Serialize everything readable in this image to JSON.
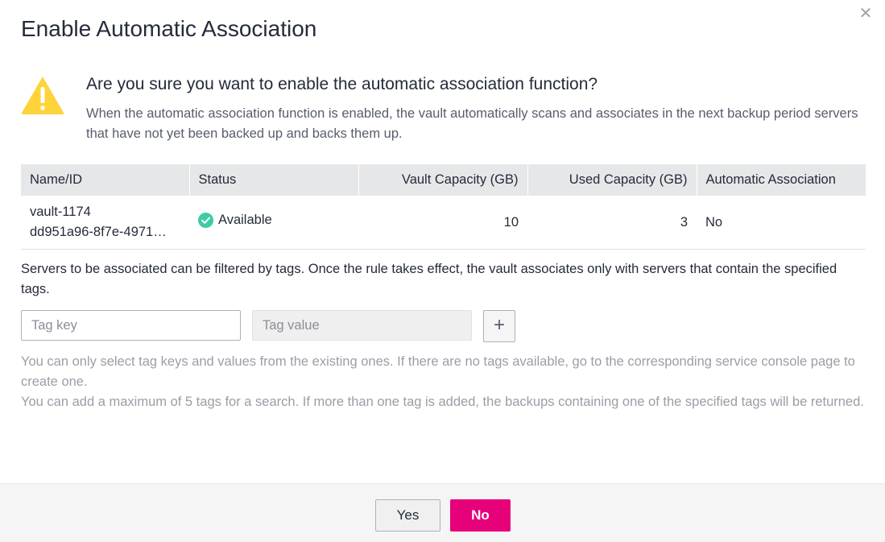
{
  "dialog": {
    "title": "Enable Automatic Association",
    "close_icon": "close-icon",
    "question": "Are you sure you want to enable the automatic association function?",
    "description": "When the automatic association function is enabled, the vault automatically scans and associates in the next backup period servers that have not yet been backed up and backs them up.",
    "warning_icon": "warning-triangle-icon",
    "warning_color": "#ffd33a"
  },
  "table": {
    "headers": [
      "Name/ID",
      "Status",
      "Vault Capacity (GB)",
      "Used Capacity (GB)",
      "Automatic Association"
    ],
    "row": {
      "name": "vault-1174",
      "id": "dd951a96-8f7e-4971…",
      "status": "Available",
      "status_color": "#3dcca6",
      "vault_capacity": "10",
      "used_capacity": "3",
      "automatic_association": "No"
    }
  },
  "filter": {
    "text": "Servers to be associated can be filtered by tags. Once the rule takes effect, the vault associates only with servers that contain the specified tags.",
    "tag_key_placeholder": "Tag key",
    "tag_value_placeholder": "Tag value",
    "add_label": "+",
    "hint_1": "You can only select tag keys and values from the existing ones. If there are no tags available, go to the corresponding service console page to create one.",
    "hint_2": "You can add a maximum of 5 tags for a search. If more than one tag is added, the backups containing one of the specified tags will be returned."
  },
  "footer": {
    "yes_label": "Yes",
    "no_label": "No",
    "primary_color": "#e6007a"
  }
}
